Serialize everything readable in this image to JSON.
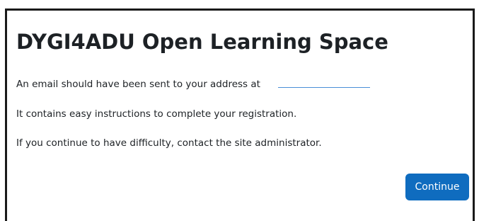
{
  "dialog": {
    "title": "DYGI4ADU Open Learning Space",
    "messages": [
      "An email should have been sent to your address at",
      "It contains easy instructions to complete your registration.",
      "If you continue to have difficulty, contact the site administrator."
    ],
    "email_value": "",
    "continue_label": "Continue"
  },
  "colors": {
    "button_bg": "#0f6cbf",
    "button_text": "#ffffff",
    "text": "#1d2125",
    "frame_border": "#1a1a1a"
  }
}
